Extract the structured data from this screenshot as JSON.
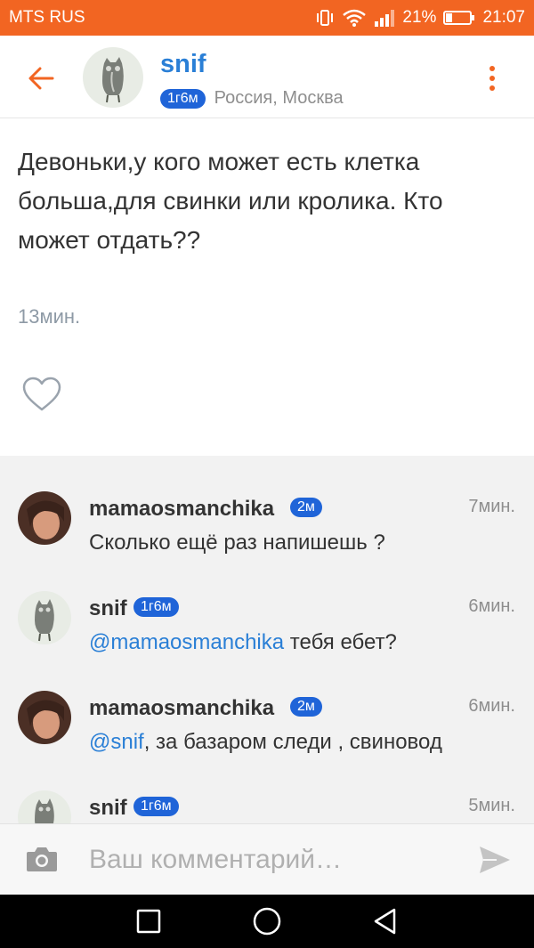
{
  "status_bar": {
    "carrier": "MTS RUS",
    "battery": "21%",
    "time": "21:07",
    "icons": [
      "vibrate-icon",
      "wifi-icon",
      "signal-icon",
      "battery-icon"
    ]
  },
  "header": {
    "back_icon": "arrow-left-icon",
    "author": "snif",
    "badge": "1г6м",
    "location": "Россия, Москва",
    "menu_icon": "more-vertical-icon"
  },
  "post": {
    "text": "Девоньки,у кого может есть клетка больша,для свинки или кролика. Кто может отдать??",
    "time": "13мин.",
    "like_icon": "heart-outline-icon"
  },
  "comments": [
    {
      "author": "mamaosmanchika",
      "badge": "2м",
      "time": "7мин.",
      "mention": "",
      "text": "Сколько ещё раз напишешь ?"
    },
    {
      "author": "snif",
      "badge": "1г6м",
      "time": "6мин.",
      "mention": "@mamaosmanchika",
      "text": " тебя ебет?"
    },
    {
      "author": "mamaosmanchika",
      "badge": "2м",
      "time": "6мин.",
      "mention": "@snif",
      "text": ", за базаром следи , свиновод"
    },
    {
      "author": "snif",
      "badge": "1г6м",
      "time": "5мин.",
      "mention": "",
      "text": ""
    }
  ],
  "input": {
    "placeholder": "Ваш комментарий…",
    "camera_icon": "camera-icon",
    "send_icon": "send-icon"
  },
  "colors": {
    "accent": "#f26522",
    "link": "#2a7fd6",
    "badge": "#1f64d8"
  }
}
